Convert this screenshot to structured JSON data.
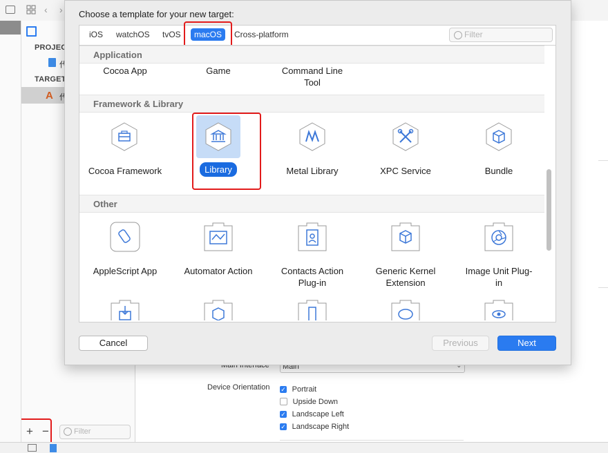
{
  "sheet": {
    "title": "Choose a template for your new target:",
    "tabs": [
      "iOS",
      "watchOS",
      "tvOS",
      "macOS",
      "Cross-platform"
    ],
    "selected_tab": "macOS",
    "filter_placeholder": "Filter",
    "groups": {
      "application": {
        "title": "Application",
        "items": [
          "Cocoa App",
          "Game",
          "Command Line\nTool"
        ]
      },
      "framework": {
        "title": "Framework & Library",
        "items": [
          "Cocoa Framework",
          "Library",
          "Metal Library",
          "XPC Service",
          "Bundle"
        ],
        "selected": "Library"
      },
      "other": {
        "title": "Other",
        "items": [
          "AppleScript App",
          "Automator Action",
          "Contacts Action\nPlug-in",
          "Generic Kernel\nExtension",
          "Image Unit Plug-\nin"
        ]
      }
    },
    "buttons": {
      "cancel": "Cancel",
      "previous": "Previous",
      "next": "Next"
    }
  },
  "background": {
    "sidebar": {
      "project_header": "PROJEC",
      "targets_header": "TARGET",
      "project_item": "代",
      "target_item": "代"
    },
    "filter_placeholder": "Filter",
    "settings": {
      "main_interface_label": "Main Interface",
      "main_interface_value": "Main",
      "device_orientation_label": "Device Orientation",
      "orientations": [
        {
          "label": "Portrait",
          "checked": true
        },
        {
          "label": "Upside Down",
          "checked": false
        },
        {
          "label": "Landscape Left",
          "checked": true
        },
        {
          "label": "Landscape Right",
          "checked": true
        }
      ]
    },
    "add_symbol": "+",
    "remove_symbol": "−"
  },
  "colors": {
    "accent": "#2a7bf0",
    "highlight_red": "#e21b1b",
    "icon_blue": "#3d78d8"
  }
}
